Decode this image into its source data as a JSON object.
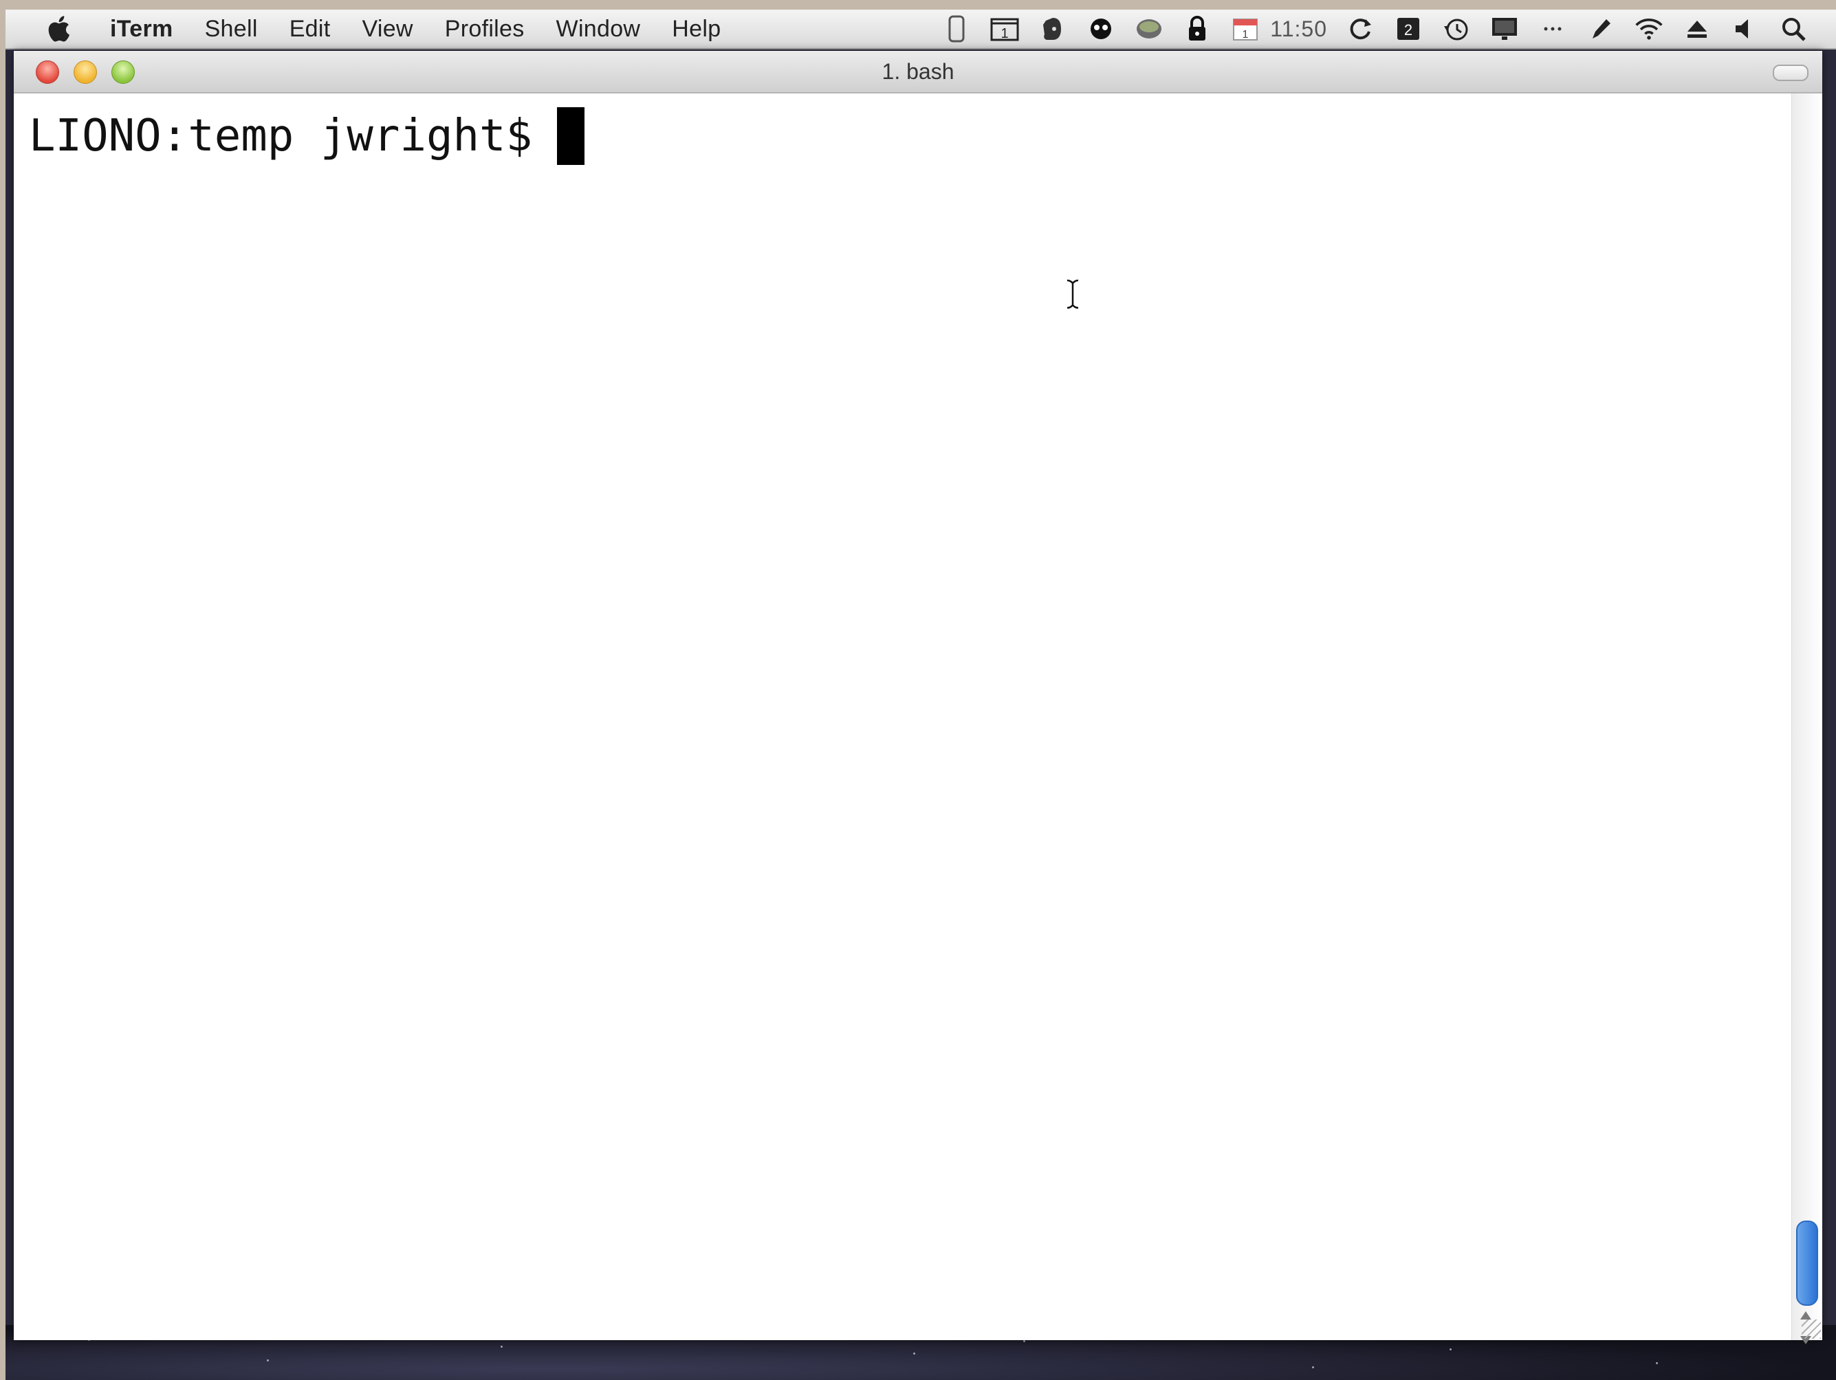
{
  "menubar": {
    "apple_icon": "apple-logo-icon",
    "app_name": "iTerm",
    "items": [
      "Shell",
      "Edit",
      "View",
      "Profiles",
      "Window",
      "Help"
    ],
    "status_icons": [
      "phone-icon",
      "calendar-one-icon",
      "evernote-icon",
      "app-eye-icon",
      "dropbox-icon",
      "lock-icon",
      "ical-icon",
      "sync-icon",
      "keyboard-icon",
      "time-machine-icon",
      "display-icon",
      "ellipsis-icon",
      "pen-icon",
      "wifi-icon",
      "eject-icon",
      "volume-icon",
      "spotlight-search-icon"
    ],
    "clock_text": "11:50"
  },
  "window": {
    "title": "1. bash"
  },
  "terminal": {
    "prompt": "LIONO:temp jwright$"
  },
  "colors": {
    "close": "#e2473a",
    "minimize": "#f0b32d",
    "maximize": "#8ac43c",
    "scroll_thumb": "#2c74d6"
  }
}
